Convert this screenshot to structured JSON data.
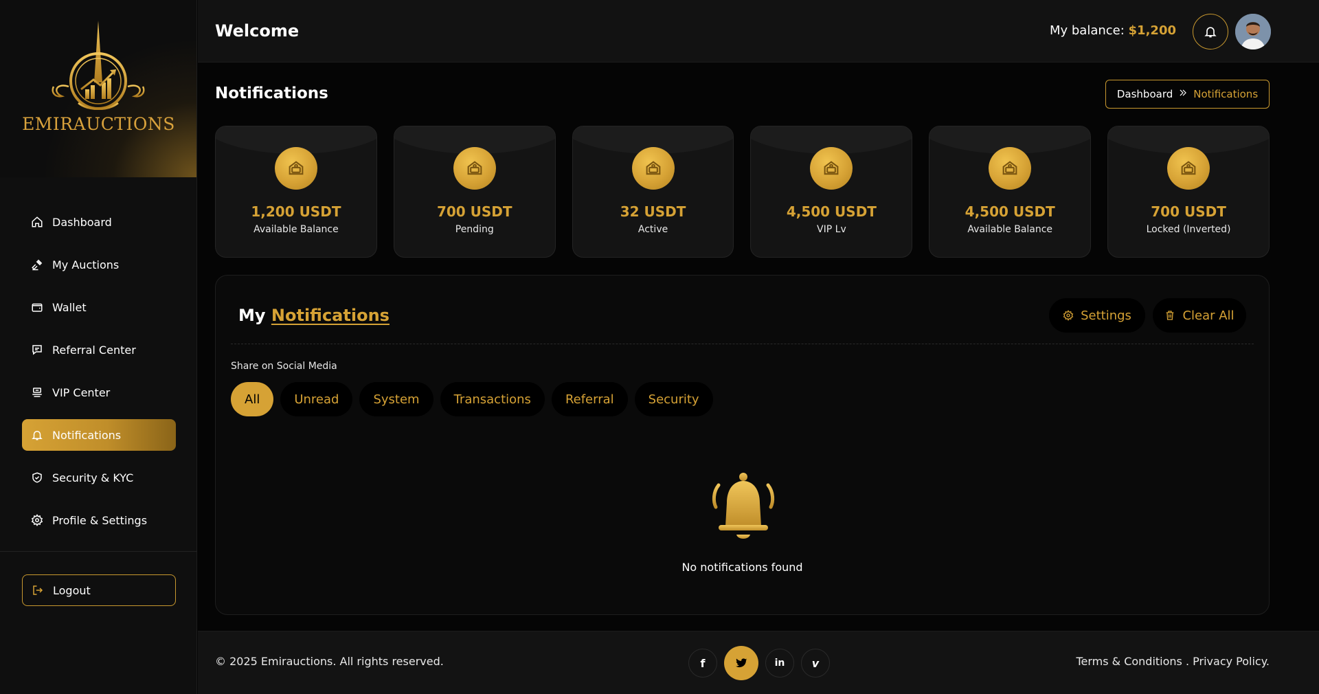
{
  "brand": {
    "name": "EMIRAUCTIONS"
  },
  "header": {
    "welcome": "Welcome",
    "balance_label": "My balance: ",
    "balance_value": "$1,200"
  },
  "sidebar": {
    "items": [
      {
        "label": "Dashboard",
        "icon": "home-icon"
      },
      {
        "label": "My Auctions",
        "icon": "gavel-icon"
      },
      {
        "label": "Wallet",
        "icon": "wallet-icon"
      },
      {
        "label": "Referral Center",
        "icon": "message-icon"
      },
      {
        "label": "VIP Center",
        "icon": "vip-icon"
      },
      {
        "label": "Notifications",
        "icon": "bell-icon",
        "active": true
      },
      {
        "label": "Security & KYC",
        "icon": "shield-icon"
      },
      {
        "label": "Profile & Settings",
        "icon": "gear-icon"
      }
    ],
    "logout": "Logout"
  },
  "page": {
    "title": "Notifications",
    "breadcrumb": {
      "home": "Dashboard",
      "current": "Notifications"
    }
  },
  "stats": [
    {
      "value": "1,200 USDT",
      "label": "Available Balance"
    },
    {
      "value": "700 USDT",
      "label": "Pending"
    },
    {
      "value": "32 USDT",
      "label": "Active"
    },
    {
      "value": "4,500 USDT",
      "label": "VIP Lv"
    },
    {
      "value": "4,500 USDT",
      "label": "Available Balance"
    },
    {
      "value": "700 USDT",
      "label": "Locked (Inverted)"
    }
  ],
  "panel": {
    "title_prefix": "My ",
    "title_highlight": "Notifications",
    "settings_label": "Settings",
    "clear_label": "Clear All",
    "share_label": "Share on Social Media",
    "tabs": [
      "All",
      "Unread",
      "System",
      "Transactions",
      "Referral",
      "Security"
    ],
    "active_tab": "All",
    "empty_message": "No notifications found"
  },
  "footer": {
    "copyright": "© 2025 Emirauctions. All rights reserved.",
    "socials": [
      "f",
      "twitter",
      "in",
      "v"
    ],
    "terms": "Terms & Conditions",
    "separator": " . ",
    "privacy": "Privacy Policy."
  },
  "colors": {
    "accent": "#d6a235",
    "background": "#050505",
    "panel": "#0a0a0a"
  }
}
